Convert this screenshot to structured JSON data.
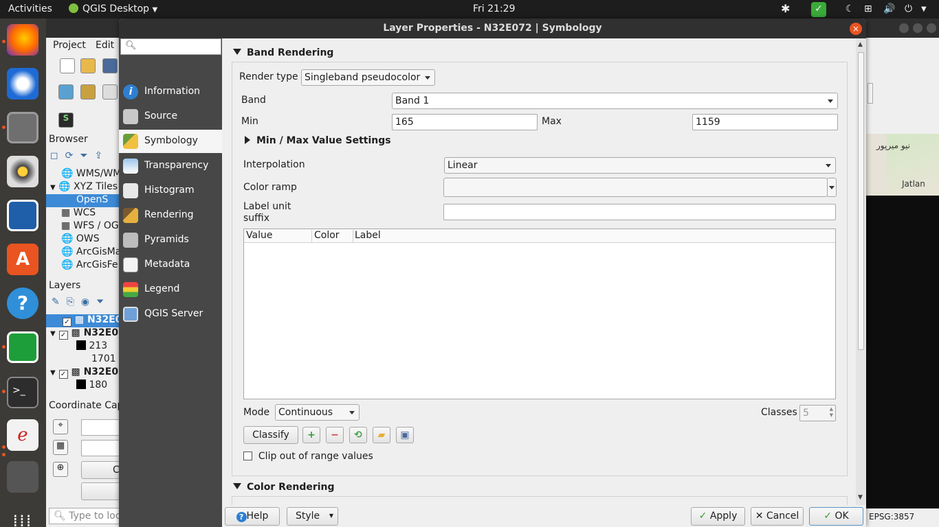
{
  "topbar": {
    "activities": "Activities",
    "app_name": "QGIS Desktop",
    "clock": "Fri 21:29"
  },
  "qgis": {
    "menu": [
      "Project",
      "Edit"
    ],
    "browser_title": "Browser",
    "browser_items": [
      "WMS/WM",
      "XYZ Tiles",
      "OpenS",
      "WCS",
      "WFS / OG",
      "OWS",
      "ArcGisMa",
      "ArcGisFe"
    ],
    "layers_title": "Layers",
    "layers": [
      "N32E0",
      "N32E0",
      "N32E0"
    ],
    "layer_values": [
      "213",
      "1701",
      "180"
    ],
    "coord_title": "Coordinate Cap",
    "coord_button": "C",
    "locator_placeholder": "Type to loc",
    "status_epsg": "EPSG:3857",
    "map_labels": [
      "نیو میرپور",
      "Jatlan"
    ]
  },
  "dialog": {
    "title": "Layer Properties - N32E072 | Symbology",
    "close_glyph": "×",
    "nav": [
      {
        "label": "Information",
        "icon": "info-icon"
      },
      {
        "label": "Source",
        "icon": "source-icon"
      },
      {
        "label": "Symbology",
        "icon": "symbology-icon"
      },
      {
        "label": "Transparency",
        "icon": "transparency-icon"
      },
      {
        "label": "Histogram",
        "icon": "histogram-icon"
      },
      {
        "label": "Rendering",
        "icon": "rendering-icon"
      },
      {
        "label": "Pyramids",
        "icon": "pyramids-icon"
      },
      {
        "label": "Metadata",
        "icon": "metadata-icon"
      },
      {
        "label": "Legend",
        "icon": "legend-icon"
      },
      {
        "label": "QGIS Server",
        "icon": "qgis-server-icon"
      }
    ],
    "band_rendering": {
      "heading": "Band Rendering",
      "render_type_label": "Render type",
      "render_type_value": "Singleband pseudocolor",
      "band_label": "Band",
      "band_value": "Band 1",
      "min_label": "Min",
      "min_value": "165",
      "max_label": "Max",
      "max_value": "1159",
      "minmax_settings": "Min / Max Value Settings",
      "interpolation_label": "Interpolation",
      "interpolation_value": "Linear",
      "color_ramp_label": "Color ramp",
      "label_unit_label_line1": "Label unit",
      "label_unit_label_line2": "suffix",
      "label_unit_value": "",
      "table_headers": [
        "Value",
        "Color",
        "Label"
      ],
      "mode_label": "Mode",
      "mode_value": "Continuous",
      "classes_label": "Classes",
      "classes_value": "5",
      "classify_button": "Classify",
      "clip_label": "Clip out of range values",
      "clip_checked": false
    },
    "color_rendering_heading": "Color Rendering",
    "buttons": {
      "help": "Help",
      "style": "Style",
      "apply": "Apply",
      "cancel": "Cancel",
      "ok": "OK"
    }
  },
  "colors": {
    "accent": "#e95420",
    "nav_bg": "#474747",
    "selected_layer": "#3d8ad6"
  }
}
